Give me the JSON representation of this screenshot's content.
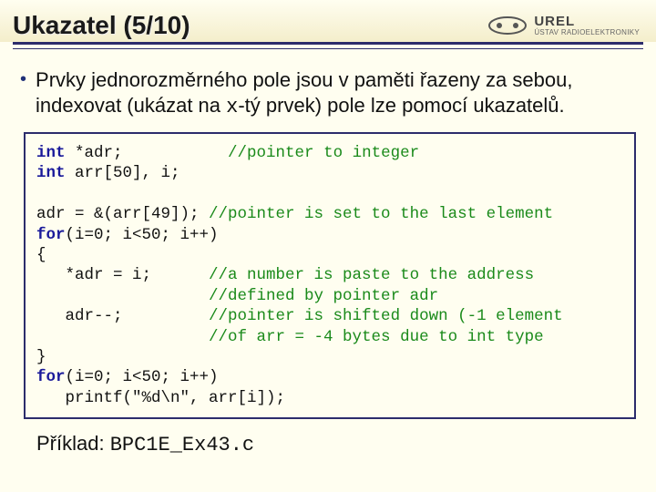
{
  "header": {
    "title": "Ukazatel (5/10)",
    "logo_brand": "UREL",
    "logo_sub": "ÚSTAV RADIOELEKTRONIKY"
  },
  "bullet": {
    "pre": "Prvky jednorozměrného pole jsou v paměti řazeny za sebou, indexovat (ukázat na ",
    "code": "x",
    "post": "-tý prvek) pole lze pomocí ukazatelů."
  },
  "code": {
    "l01a": "int",
    "l01b": " *adr;           ",
    "l01c": "//pointer to integer",
    "l02a": "int",
    "l02b": " arr[50], i;",
    "blank1": "",
    "l03a": "adr = &(arr[49]); ",
    "l03b": "//pointer is set to the last element",
    "l04a": "for",
    "l04b": "(i=0; i<50; i++)",
    "l05": "{",
    "l06a": "   *adr = i;      ",
    "l06b": "//a number is paste to the address",
    "l07a": "                  ",
    "l07b": "//defined by pointer adr",
    "l08a": "   adr--;         ",
    "l08b": "//pointer is shifted down (-1 element",
    "l09a": "                  ",
    "l09b": "//of arr = -4 bytes due to int type",
    "l10": "}",
    "l11a": "for",
    "l11b": "(i=0; i<50; i++)",
    "l12": "   printf(\"%d\\n\", arr[i]);"
  },
  "footer": {
    "label": "Příklad: ",
    "file": "BPC1E_Ex43.c"
  }
}
